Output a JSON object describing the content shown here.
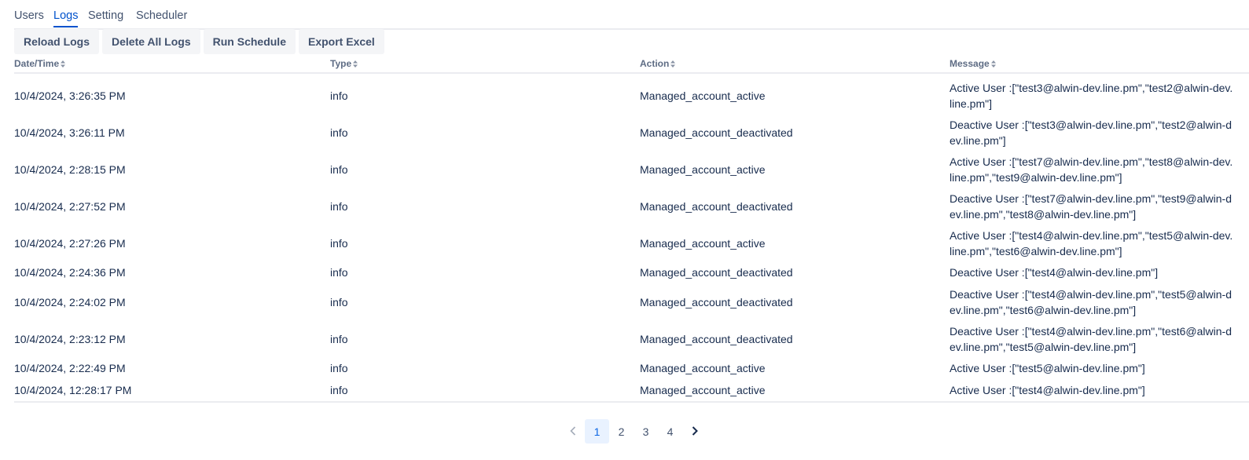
{
  "tabs": [
    {
      "label": "Users",
      "active": false
    },
    {
      "label": "Logs",
      "active": true
    },
    {
      "label": "Setting",
      "active": false
    },
    {
      "label": "Scheduler",
      "active": false
    }
  ],
  "toolbar": {
    "reload_label": "Reload Logs",
    "delete_label": "Delete All Logs",
    "run_label": "Run Schedule",
    "export_label": "Export Excel"
  },
  "table": {
    "columns": [
      "Date/Time",
      "Type",
      "Action",
      "Message"
    ],
    "rows": [
      {
        "datetime": "10/4/2024, 3:26:35 PM",
        "type": "info",
        "action": "Managed_account_active",
        "message": "Active User :[\"test3@alwin-dev.line.pm\",\"test2@alwin-dev.line.pm\"]"
      },
      {
        "datetime": "10/4/2024, 3:26:11 PM",
        "type": "info",
        "action": "Managed_account_deactivated",
        "message": "Deactive User :[\"test3@alwin-dev.line.pm\",\"test2@alwin-dev.line.pm\"]"
      },
      {
        "datetime": "10/4/2024, 2:28:15 PM",
        "type": "info",
        "action": "Managed_account_active",
        "message": "Active User :[\"test7@alwin-dev.line.pm\",\"test8@alwin-dev.line.pm\",\"test9@alwin-dev.line.pm\"]"
      },
      {
        "datetime": "10/4/2024, 2:27:52 PM",
        "type": "info",
        "action": "Managed_account_deactivated",
        "message": "Deactive User :[\"test7@alwin-dev.line.pm\",\"test9@alwin-dev.line.pm\",\"test8@alwin-dev.line.pm\"]"
      },
      {
        "datetime": "10/4/2024, 2:27:26 PM",
        "type": "info",
        "action": "Managed_account_active",
        "message": "Active User :[\"test4@alwin-dev.line.pm\",\"test5@alwin-dev.line.pm\",\"test6@alwin-dev.line.pm\"]"
      },
      {
        "datetime": "10/4/2024, 2:24:36 PM",
        "type": "info",
        "action": "Managed_account_deactivated",
        "message": "Deactive User :[\"test4@alwin-dev.line.pm\"]"
      },
      {
        "datetime": "10/4/2024, 2:24:02 PM",
        "type": "info",
        "action": "Managed_account_deactivated",
        "message": "Deactive User :[\"test4@alwin-dev.line.pm\",\"test5@alwin-dev.line.pm\",\"test6@alwin-dev.line.pm\"]"
      },
      {
        "datetime": "10/4/2024, 2:23:12 PM",
        "type": "info",
        "action": "Managed_account_deactivated",
        "message": "Deactive User :[\"test4@alwin-dev.line.pm\",\"test6@alwin-dev.line.pm\",\"test5@alwin-dev.line.pm\"]"
      },
      {
        "datetime": "10/4/2024, 2:22:49 PM",
        "type": "info",
        "action": "Managed_account_active",
        "message": "Active User :[\"test5@alwin-dev.line.pm\"]"
      },
      {
        "datetime": "10/4/2024, 12:28:17 PM",
        "type": "info",
        "action": "Managed_account_active",
        "message": "Active User :[\"test4@alwin-dev.line.pm\"]"
      }
    ]
  },
  "pagination": {
    "pages": [
      "1",
      "2",
      "3",
      "4"
    ],
    "current": "1",
    "prev_icon": "chevron-left-icon",
    "next_icon": "chevron-right-icon"
  },
  "colors": {
    "accent": "#0052cc",
    "current_page_bg": "#e9f2ff",
    "button_bg": "#f4f5f7"
  }
}
